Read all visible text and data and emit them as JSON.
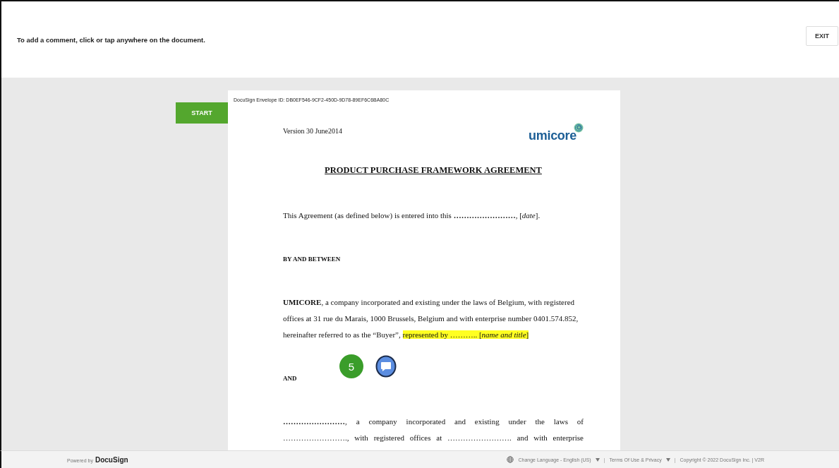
{
  "top_bar": {
    "instruction": "To add a comment, click or tap anywhere on the document.",
    "exit_button": "EXIT"
  },
  "start_button": "START",
  "document": {
    "envelope_id": "DocuSign Envelope ID: DB0EF546-9CF2-450D-9D78-89EF6C6BA80C",
    "version": "Version 30 June2014",
    "logo": "umicore",
    "title": "PRODUCT PURCHASE FRAMEWORK AGREEMENT",
    "blocks": [
      {
        "kind": "para",
        "segments": [
          {
            "text": "This Agreement (as defined below) is entered into this **……………………**, [*date*].",
            "highlight": false
          }
        ]
      },
      {
        "kind": "heading",
        "segments": [
          {
            "text": "BY AND BETWEEN",
            "highlight": false
          }
        ]
      },
      {
        "kind": "para",
        "segments": [
          {
            "text": "**UMICORE**, a company incorporated and existing under the laws of Belgium, with registered offices at 31 rue du Marais, 1000 Brussels, Belgium and with enterprise number 0401.574.852, hereinafter referred to as the “Buyer”, ",
            "highlight": false
          },
          {
            "text": "represented by ……….. [*name and title*]",
            "highlight": true
          }
        ]
      },
      {
        "kind": "heading",
        "segments": [
          {
            "text": "AND",
            "highlight": false
          }
        ]
      },
      {
        "kind": "justified",
        "segments": [
          {
            "text": "**……………………**, a company incorporated and existing under the laws of ……………………., with registered offices at ……………………. and with enterprise",
            "highlight": false
          }
        ]
      }
    ],
    "step_badge": "5"
  },
  "footer": {
    "powered_by": "Powered by",
    "brand": "DocuSign",
    "language": "Change Language - English (US)",
    "separator_1": "|",
    "terms": "Terms Of Use & Privacy",
    "separator_2": "|",
    "copyright": "Copyright © 2022 DocuSign Inc. | V2R"
  }
}
